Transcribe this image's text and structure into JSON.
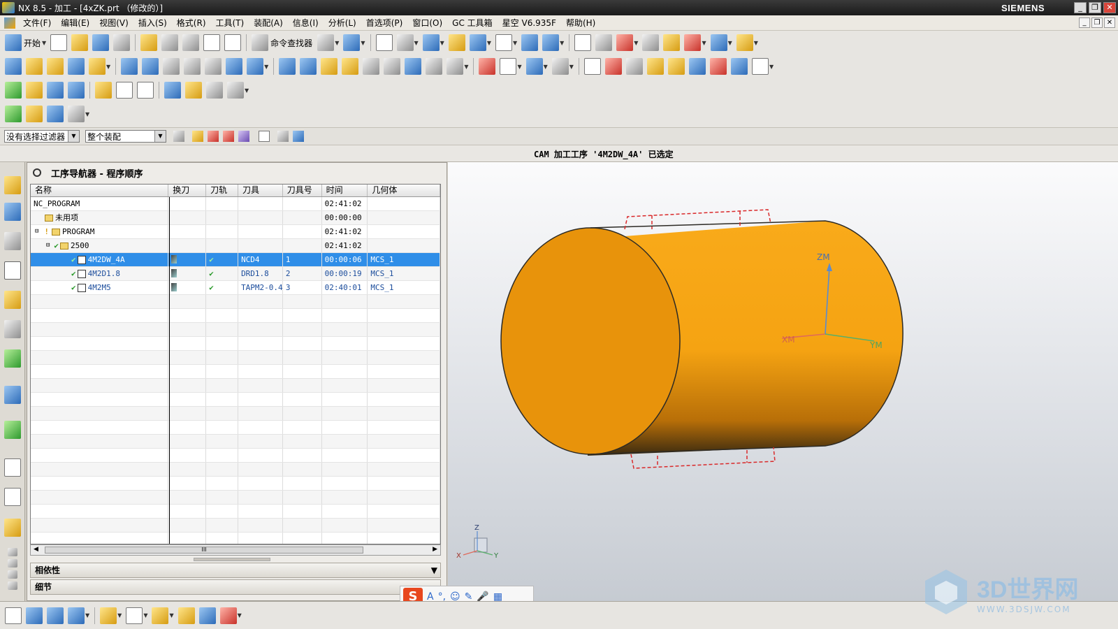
{
  "window": {
    "title": "NX 8.5 - 加工 - [4xZK.prt （修改的）]",
    "brand": "SIEMENS",
    "min": "_",
    "restore": "❐",
    "close": "✕"
  },
  "menu": {
    "items": [
      "文件(F)",
      "编辑(E)",
      "视图(V)",
      "插入(S)",
      "格式(R)",
      "工具(T)",
      "装配(A)",
      "信息(I)",
      "分析(L)",
      "首选项(P)",
      "窗口(O)",
      "GC 工具箱",
      "星空 V6.935F",
      "帮助(H)"
    ]
  },
  "toolbar": {
    "start_label": "开始",
    "command_finder_label": "命令查找器",
    "colors": {
      "blue": "#2d6bb8",
      "yellow": "#d69c12",
      "green": "#2e9a2e"
    }
  },
  "filter": {
    "selection_filter": "没有选择过滤器",
    "scope": "整个装配"
  },
  "cue": {
    "text": "CAM 加工工序 '4M2DW_4A' 已选定"
  },
  "navigator": {
    "title": "工序导航器 - 程序顺序",
    "columns": [
      "名称",
      "换刀",
      "刀轨",
      "刀具",
      "刀具号",
      "时间",
      "几何体"
    ],
    "rows": [
      {
        "name": "NC_PROGRAM",
        "tool": "",
        "tool_no": "",
        "time": "02:41:02",
        "geometry": ""
      },
      {
        "name": "未用项",
        "tool": "",
        "tool_no": "",
        "time": "00:00:00",
        "geometry": ""
      },
      {
        "name": "PROGRAM",
        "tool": "",
        "tool_no": "",
        "time": "02:41:02",
        "geometry": ""
      },
      {
        "name": "2500",
        "tool": "",
        "tool_no": "",
        "time": "02:41:02",
        "geometry": ""
      },
      {
        "name": "4M2DW_4A",
        "tool": "NCD4",
        "tool_no": "1",
        "time": "00:00:06",
        "geometry": "MCS_1",
        "selected": true
      },
      {
        "name": "4M2D1.8",
        "tool": "DRD1.8",
        "tool_no": "2",
        "time": "00:00:19",
        "geometry": "MCS_1"
      },
      {
        "name": "4M2M5",
        "tool": "TAPM2-0.4",
        "tool_no": "3",
        "time": "02:40:01",
        "geometry": "MCS_1"
      }
    ],
    "toolpath_mark": "✔",
    "dependency_label": "相依性",
    "details_label": "细节",
    "scroll_grip": "III"
  },
  "graphics": {
    "part_color": "#f5a312",
    "axis_labels": {
      "zm": "ZM",
      "xm": "XM",
      "ym": "YM"
    },
    "triad_labels": {
      "z": "Z",
      "x": "X",
      "y": "Y"
    }
  },
  "ime": {
    "logo": "S",
    "a": "A",
    "punct": "°,",
    "emoji": "☺",
    "pen": "✎",
    "mic": "🎤",
    "grid": "▦"
  },
  "watermark": {
    "title": "3D世界网",
    "url": "WWW.3DSJW.COM"
  }
}
